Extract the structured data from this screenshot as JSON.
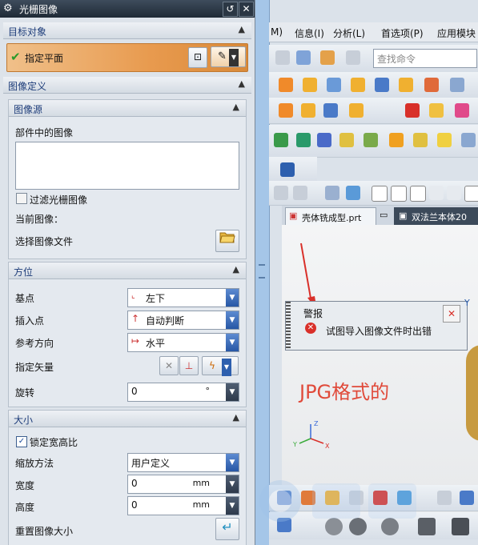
{
  "dialog": {
    "title": "光栅图像",
    "target_section": {
      "title": "目标对象",
      "plane_label": "指定平面"
    },
    "image_def_section": {
      "title": "图像定义"
    },
    "image_source": {
      "title": "图像源",
      "part_images_label": "部件中的图像",
      "filter_label": "过滤光栅图像",
      "current_image_label": "当前图像：",
      "select_file_label": "选择图像文件"
    },
    "orientation": {
      "title": "方位",
      "base_point": {
        "label": "基点",
        "value": "左下"
      },
      "insert_point": {
        "label": "插入点",
        "value": "自动判断"
      },
      "ref_direction": {
        "label": "参考方向",
        "value": "水平"
      },
      "vector": {
        "label": "指定矢量"
      },
      "rotation": {
        "label": "旋转",
        "value": "0",
        "unit": "°"
      }
    },
    "size": {
      "title": "大小",
      "lock_label": "锁定宽高比",
      "lock_checked": true,
      "scale_method": {
        "label": "缩放方法",
        "value": "用户定义"
      },
      "width": {
        "label": "宽度",
        "value": "0",
        "unit": "mm"
      },
      "height": {
        "label": "高度",
        "value": "0",
        "unit": "mm"
      },
      "reset_label": "重置图像大小"
    }
  },
  "app": {
    "menu": {
      "m": "M)",
      "info": "信息(I)",
      "analysis": "分析(L)",
      "preferences": "首选项(P)",
      "app": "应用模块"
    },
    "search_placeholder": "查找命令",
    "tabs": {
      "tab1": "壳体铣成型.prt",
      "tab2": "双法兰本体20"
    },
    "message": {
      "title": "警报",
      "text": "试图导入图像文件时出错"
    },
    "annotation": "JPG格式的",
    "axis": {
      "z": "Z",
      "y": "Y",
      "x": "X",
      "y2": "Y"
    }
  },
  "colors": {
    "accent": "#e89a4e",
    "error": "#d9302a",
    "annotation": "#e04a3a",
    "combo_arrow": "#2d5fae"
  }
}
